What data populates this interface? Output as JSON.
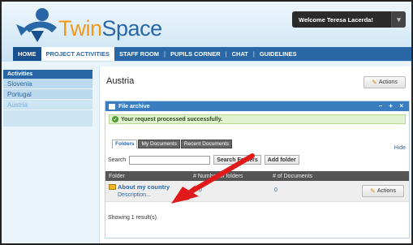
{
  "header": {
    "logo_twin": "Twin",
    "logo_space": "Space",
    "welcome_text": "Welcome Teresa Lacerda!"
  },
  "nav": {
    "items": [
      "HOME",
      "PROJECT ACTIVITIES",
      "STAFF ROOM",
      "PUPILS CORNER",
      "CHAT",
      "GUIDELINES"
    ]
  },
  "sidebar": {
    "title": "Activities",
    "items": [
      "Slovenia",
      "Portugal",
      "Austria"
    ]
  },
  "main": {
    "page_title": "Austria",
    "actions_label": "Actions",
    "portlet_title": "File archive",
    "portlet_controls": "– + ×",
    "success_message": "Your request processed successfully.",
    "hide_label": "Hide",
    "tabs": [
      "Folders",
      "My Documents",
      "Recent Documents"
    ],
    "search_label": "Search",
    "search_button": "Search Folders",
    "add_folder_button": "Add folder",
    "columns": [
      "Folder",
      "# Number of folders",
      "# of Documents"
    ],
    "rows": [
      {
        "name": "About my country",
        "description": "Description...",
        "folders": "0",
        "documents": "0"
      }
    ],
    "result_count": "Showing 1 result(s)."
  },
  "colors": {
    "brand_blue": "#2a67a6",
    "brand_orange": "#f29a16",
    "arrow_red": "#e01a1a"
  }
}
